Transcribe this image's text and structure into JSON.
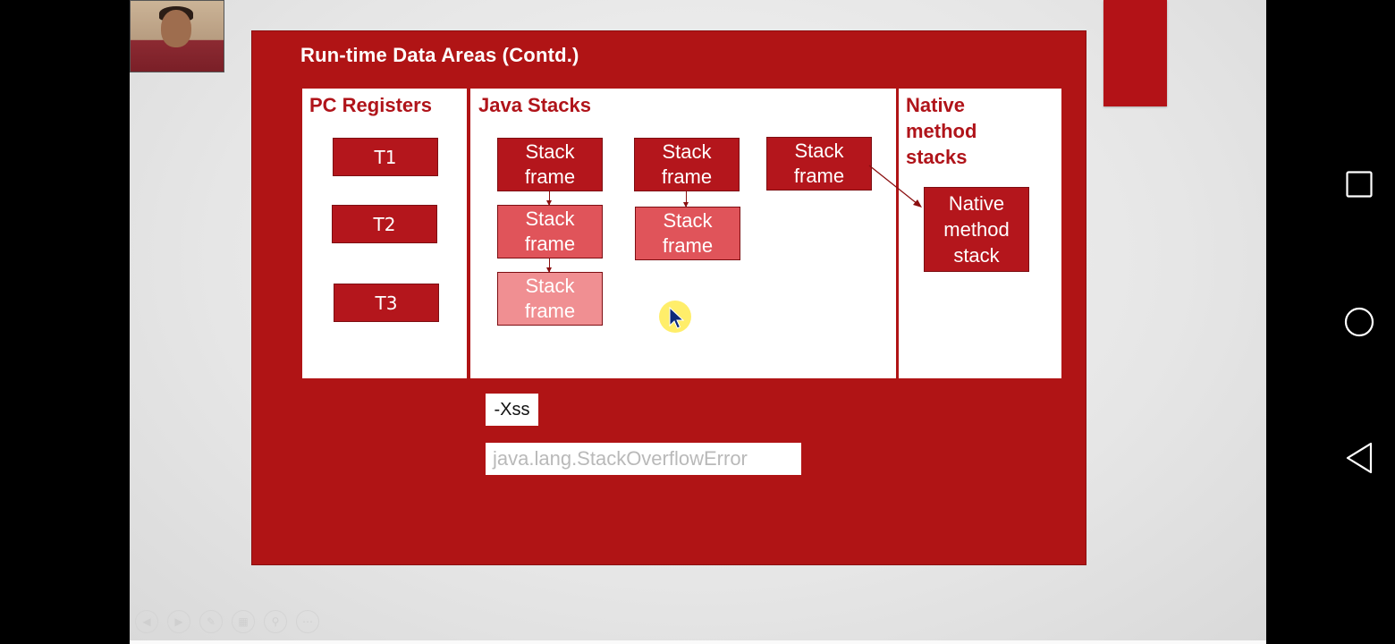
{
  "slide": {
    "title": "Run-time Data Areas (Contd.)",
    "pc_registers": {
      "title": "PC Registers",
      "threads": [
        "T1",
        "T2",
        "T3"
      ]
    },
    "java_stacks": {
      "title": "Java Stacks",
      "frame_label": "Stack\nframe"
    },
    "native_method_stacks": {
      "title": "Native\nmethod\nstacks",
      "box_label": "Native\nmethod\nstack"
    },
    "xss_label": "-Xss",
    "error_text": "java.lang.StackOverflowError"
  },
  "colors": {
    "slide_red": "#b01415",
    "frame_dark": "#b4161c",
    "frame_medium": "#e0545a",
    "frame_light": "#f08f92"
  },
  "viewer_controls": [
    "prev-icon",
    "next-icon",
    "pen-icon",
    "slides-icon",
    "zoom-icon",
    "more-icon"
  ],
  "android_nav": [
    "recents-icon",
    "home-icon",
    "back-icon"
  ]
}
